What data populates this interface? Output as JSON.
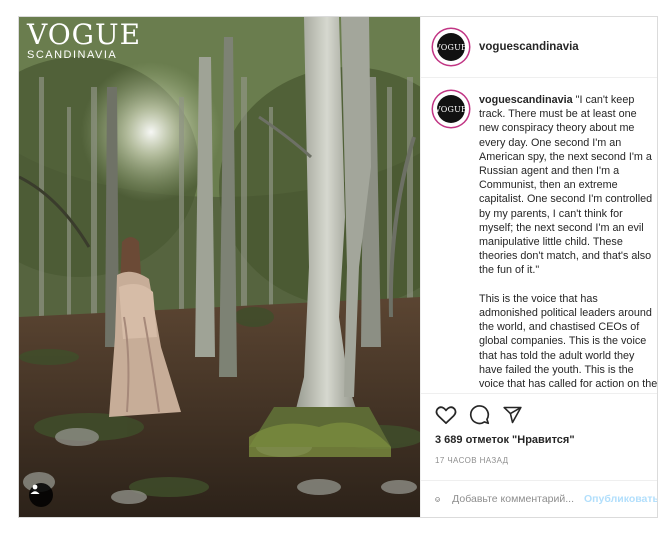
{
  "photo": {
    "logo_mark": "VOGUE",
    "logo_region": "SCANDINAVIA",
    "tag_icon": "user-tag-icon"
  },
  "header": {
    "username": "voguescandinavia",
    "avatar_label": "VOGUE"
  },
  "caption": {
    "username": "voguescandinavia",
    "paragraph1": "\"I can't keep track. There must be at least one new conspiracy theory about me every day. One second I'm an American spy, the next second I'm a Russian agent and then I'm a Communist, then an extreme capitalist. One second I'm controlled by my parents, I can't think for myself; the next second I'm an evil manipulative little child. These theories don't match, and that's also the fun of it.\"",
    "paragraph2": "This is the voice that has admonished political leaders around the world, and chastised CEOs of global companies. This is the voice that has told the adult world they have failed the youth. This is the voice that has called for action on the climate crisis, told us that the"
  },
  "actions": {
    "like_icon": "heart-icon",
    "comment_icon": "comment-icon",
    "share_icon": "paper-plane-icon",
    "likes_text": "3 689 отметок \"Нравится\"",
    "timestamp": "17 ЧАСОВ НАЗАД"
  },
  "comment_box": {
    "emoji_icon": "emoji-icon",
    "placeholder": "Добавьте комментарий...",
    "post_label": "Опубликовать"
  }
}
